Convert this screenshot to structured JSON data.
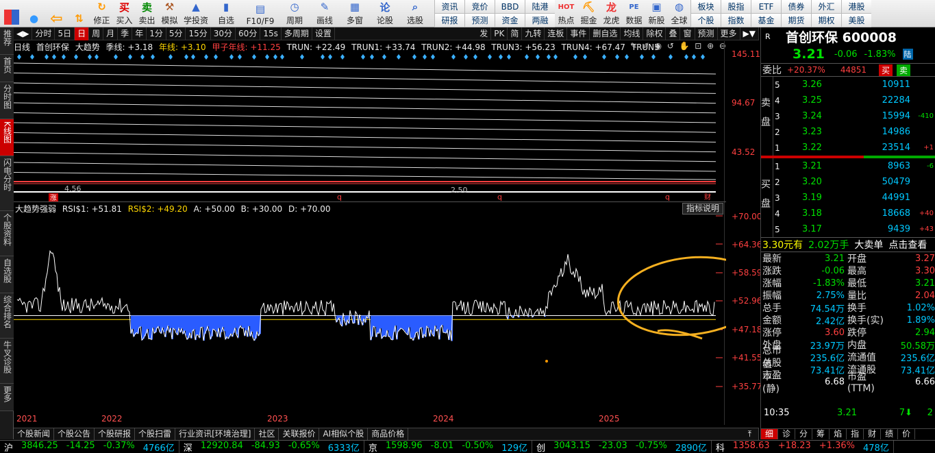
{
  "toolbar": {
    "buttons": [
      {
        "label": "",
        "icon": "grid-icon"
      },
      {
        "label": "",
        "icon": "robot-icon"
      },
      {
        "label": "",
        "icon": "back-arrow-icon"
      },
      {
        "label": "",
        "icon": "up-down-arrows-icon"
      },
      {
        "label": "修正",
        "icon": "refresh-icon"
      },
      {
        "label": "买入",
        "icon": "buy-icon"
      },
      {
        "label": "卖出",
        "icon": "sell-icon"
      },
      {
        "label": "模拟",
        "icon": "hammer-icon"
      },
      {
        "label": "学投资",
        "icon": "graduation-icon"
      },
      {
        "label": "自选",
        "icon": "bookmark-icon"
      },
      {
        "label": "F10/F9",
        "icon": "f10-icon"
      },
      {
        "label": "周期",
        "icon": "clock-icon"
      },
      {
        "label": "画线",
        "icon": "pen-icon"
      },
      {
        "label": "多窗",
        "icon": "windows-icon"
      },
      {
        "label": "论股",
        "icon": "discuss-icon"
      },
      {
        "label": "选股",
        "icon": "search-icon"
      }
    ],
    "grid": [
      [
        "资讯",
        "竞价",
        "BBD",
        "陆港",
        "HOT",
        "",
        "龙虎",
        "PE",
        "",
        "",
        "板块",
        "股指",
        "ETF",
        "债券"
      ],
      [
        "研报",
        "预测",
        "资金",
        "两融",
        "热点",
        "掘金",
        "龙虎",
        "数据",
        "新股",
        "全球",
        "个股",
        "指数",
        "基金",
        "期货"
      ]
    ],
    "grid_top": [
      "资讯",
      "竞价",
      "BBD",
      "陆港",
      "板块",
      "股指",
      "ETF",
      "债券",
      "外汇",
      "港股"
    ],
    "grid_bottom": [
      "研报",
      "预测",
      "资金",
      "两融",
      "个股",
      "指数",
      "基金",
      "期货",
      "期权",
      "美股"
    ],
    "mid_labels": [
      "热点",
      "掘金",
      "龙虎",
      "数据",
      "新股",
      "全球"
    ]
  },
  "left_tabs": [
    "推荐",
    "首页",
    "分时图",
    "K线图",
    "闪电分时",
    "个股资料",
    "自选股",
    "综合排名",
    "牛叉诊股",
    "更多"
  ],
  "left_tab_active": 3,
  "period_bar": {
    "items": [
      "分时",
      "5日",
      "日",
      "周",
      "月",
      "季",
      "年",
      "1分",
      "5分",
      "15分",
      "30分",
      "60分",
      "15s",
      "多周期",
      "设置"
    ],
    "selected": 2,
    "right_items": [
      "发",
      "PK",
      "简",
      "九转",
      "连板",
      "事件",
      "删自选",
      "均线",
      "除权",
      "叠",
      "窗",
      "预测",
      "更多"
    ]
  },
  "main_header": {
    "period": "日线",
    "stock": "首创环保",
    "indicator": "大趋势",
    "items": [
      {
        "text": "季线: +3.18",
        "color": "white"
      },
      {
        "text": "年线: +3.10",
        "color": "yellow"
      },
      {
        "text": "甲子年线: +11.25",
        "color": "red"
      },
      {
        "text": "TRUN: +22.49",
        "color": "white"
      },
      {
        "text": "TRUN1: +33.74",
        "color": "white"
      },
      {
        "text": "TRUN2: +44.98",
        "color": "white"
      },
      {
        "text": "TRUN3: +56.23",
        "color": "white"
      },
      {
        "text": "TRUN4: +67.47",
        "color": "white"
      },
      {
        "text": "TRUN5",
        "color": "white"
      }
    ]
  },
  "main_axis": [
    "145.11",
    "94.67",
    "43.52"
  ],
  "main_marks": {
    "low1": "4.56",
    "low2": "2.50",
    "q": "q",
    "zhang": "涨",
    "cai": "财"
  },
  "rsi_header": {
    "title": "大趋势强弱",
    "rsi1": "RSI$1: +51.81",
    "rsi2": "RSI$2: +49.20",
    "a": "A: +50.00",
    "b": "B: +30.00",
    "d": "D: +70.00",
    "explain": "指标说明"
  },
  "rsi_axis": [
    "+70.00",
    "+64.36",
    "+58.59",
    "+52.96",
    "+47.18",
    "+41.55",
    "+35.77"
  ],
  "years": [
    "2021",
    "2022",
    "2023",
    "2024",
    "2025"
  ],
  "bottom_tabs": [
    "个股新闻",
    "个股公告",
    "个股研报",
    "个股扫雷",
    "行业资讯[环境治理]",
    "社区",
    "关联报价",
    "AI相似个股",
    "商品价格"
  ],
  "right_panel": {
    "r": "R",
    "name": "首创环保 600008",
    "price": "3.21",
    "change": "-0.06",
    "pct": "-1.83%",
    "tag": "陆",
    "ratio_label": "委比",
    "ratio_pct": "+20.37%",
    "ratio_vol": "44851",
    "buy_btn": "买",
    "sell_btn": "卖",
    "sell_side": "卖盘",
    "buy_side": "买盘",
    "asks": [
      {
        "lv": "5",
        "price": "3.26",
        "vol": "10911",
        "chg": ""
      },
      {
        "lv": "4",
        "price": "3.25",
        "vol": "22284",
        "chg": ""
      },
      {
        "lv": "3",
        "price": "3.24",
        "vol": "15994",
        "chg": "-410"
      },
      {
        "lv": "2",
        "price": "3.23",
        "vol": "14986",
        "chg": ""
      },
      {
        "lv": "1",
        "price": "3.22",
        "vol": "23514",
        "chg": "+1"
      }
    ],
    "bids": [
      {
        "lv": "1",
        "price": "3.21",
        "vol": "8963",
        "chg": "-6"
      },
      {
        "lv": "2",
        "price": "3.20",
        "vol": "50479",
        "chg": ""
      },
      {
        "lv": "3",
        "price": "3.19",
        "vol": "44991",
        "chg": ""
      },
      {
        "lv": "4",
        "price": "3.18",
        "vol": "18668",
        "chg": "+40"
      },
      {
        "lv": "5",
        "price": "3.17",
        "vol": "9439",
        "chg": "+43"
      }
    ],
    "big_order": {
      "p": "3.30元有",
      "v": "2.02万手",
      "t": "大卖单",
      "link": "点击查看"
    },
    "stats": [
      [
        "最新",
        "3.21",
        "开盘",
        "3.27"
      ],
      [
        "涨跌",
        "-0.06",
        "最高",
        "3.30"
      ],
      [
        "涨幅",
        "-1.83%",
        "最低",
        "3.21"
      ],
      [
        "振幅",
        "2.75%",
        "量比",
        "2.04"
      ],
      [
        "总手",
        "74.54万",
        "换手",
        "1.02%"
      ],
      [
        "金额",
        "2.42亿",
        "换手(实)",
        "1.89%"
      ],
      [
        "涨停",
        "3.60",
        "跌停",
        "2.94"
      ],
      [
        "外盘",
        "23.97万",
        "内盘",
        "50.58万"
      ],
      [
        "总市值",
        "235.6亿",
        "流通值",
        "235.6亿"
      ],
      [
        "总股本",
        "73.41亿",
        "流通股",
        "73.41亿"
      ],
      [
        "市盈(静)",
        "6.68",
        "市盈(TTM)",
        "6.66"
      ]
    ],
    "time": "10:35",
    "time_price": "3.21",
    "time_vol": "7",
    "time_num": "2",
    "tabs": [
      "细",
      "诊",
      "分",
      "筹",
      "焰",
      "指",
      "财",
      "绩",
      "价"
    ]
  },
  "ticker": [
    {
      "name": "沪",
      "val": "3846.25",
      "chg": "-14.25",
      "pct": "-0.37%",
      "amt": "4766亿"
    },
    {
      "name": "深",
      "val": "12920.84",
      "chg": "-84.93",
      "pct": "-0.65%",
      "amt": "6333亿"
    },
    {
      "name": "京",
      "val": "1598.96",
      "chg": "-8.01",
      "pct": "-0.50%",
      "amt": "129亿"
    },
    {
      "name": "创",
      "val": "3043.15",
      "chg": "-23.03",
      "pct": "-0.75%",
      "amt": "2890亿"
    },
    {
      "name": "科",
      "val": "1358.63",
      "chg": "+18.23",
      "pct": "+1.36%",
      "amt": "478亿"
    }
  ]
}
